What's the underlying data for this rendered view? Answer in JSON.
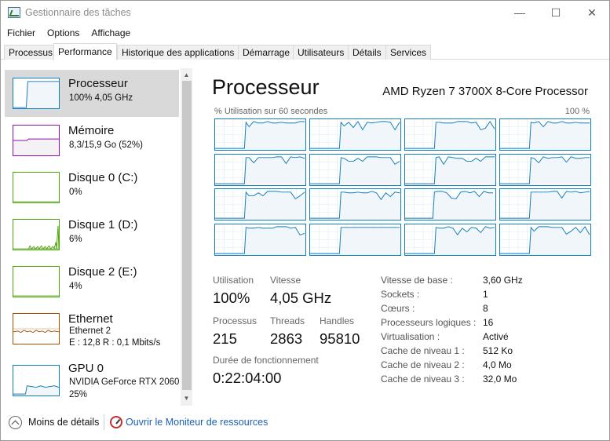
{
  "window": {
    "title": "Gestionnaire des tâches",
    "minimize": "—",
    "maximize": "☐",
    "close": "✕"
  },
  "menu": [
    "Fichier",
    "Options",
    "Affichage"
  ],
  "tabs": [
    "Processus",
    "Performance",
    "Historique des applications",
    "Démarrage",
    "Utilisateurs",
    "Détails",
    "Services"
  ],
  "active_tab": "Performance",
  "sidebar": {
    "items": [
      {
        "title": "Processeur",
        "line1": "100% 4,05 GHz",
        "line2": "",
        "color": "#117dbb"
      },
      {
        "title": "Mémoire",
        "line1": "8,3/15,9 Go (52%)",
        "line2": "",
        "color": "#8b12ae"
      },
      {
        "title": "Disque 0 (C:)",
        "line1": "0%",
        "line2": "",
        "color": "#4da60c"
      },
      {
        "title": "Disque 1 (D:)",
        "line1": "6%",
        "line2": "",
        "color": "#4da60c"
      },
      {
        "title": "Disque 2 (E:)",
        "line1": "4%",
        "line2": "",
        "color": "#4da60c"
      },
      {
        "title": "Ethernet",
        "line1": "Ethernet 2",
        "line2": "E : 12,8 R : 0,1 Mbits/s",
        "color": "#a74f01"
      },
      {
        "title": "GPU 0",
        "line1": "NVIDIA GeForce RTX 2060",
        "line2": "25%",
        "color": "#117dbb"
      }
    ]
  },
  "main": {
    "title": "Processeur",
    "cpu_name": "AMD Ryzen 7 3700X 8-Core Processor",
    "graph_caption": "% Utilisation sur 60 secondes",
    "graph_max": "100 %",
    "stats": {
      "utilisation_label": "Utilisation",
      "utilisation_value": "100%",
      "vitesse_label": "Vitesse",
      "vitesse_value": "4,05 GHz",
      "processus_label": "Processus",
      "processus_value": "215",
      "threads_label": "Threads",
      "threads_value": "2863",
      "handles_label": "Handles",
      "handles_value": "95810",
      "uptime_label": "Durée de fonctionnement",
      "uptime_value": "0:22:04:00"
    },
    "specs": [
      {
        "label": "Vitesse de base :",
        "value": "3,60 GHz"
      },
      {
        "label": "Sockets :",
        "value": "1"
      },
      {
        "label": "Cœurs :",
        "value": "8"
      },
      {
        "label": "Processeurs logiques :",
        "value": "16"
      },
      {
        "label": "Virtualisation :",
        "value": "Activé"
      },
      {
        "label": "Cache de niveau 1 :",
        "value": "512 Ko"
      },
      {
        "label": "Cache de niveau 2 :",
        "value": "4,0 Mo"
      },
      {
        "label": "Cache de niveau 3 :",
        "value": "32,0 Mo"
      }
    ]
  },
  "footer": {
    "less_details": "Moins de détails",
    "resource_monitor": "Ouvrir le Moniteur de ressources"
  },
  "colors": {
    "cpu": "#117dbb",
    "memory": "#8b12ae",
    "disk": "#4da60c",
    "ethernet": "#a74f01"
  }
}
